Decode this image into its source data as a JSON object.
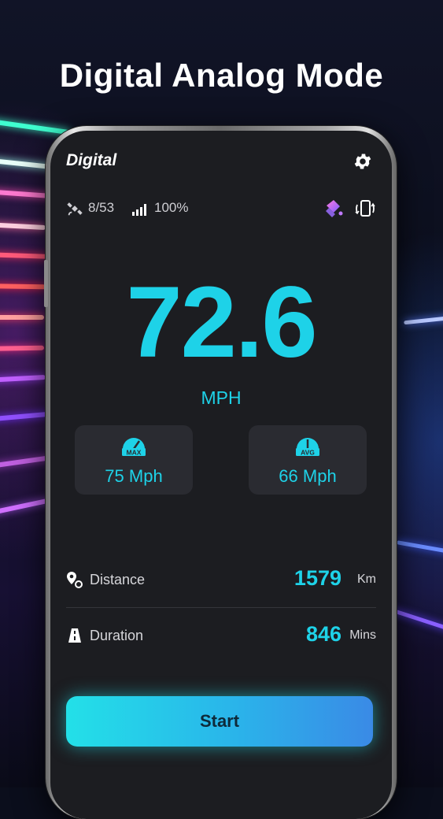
{
  "heading": "Digital Analog Mode",
  "app": {
    "title": "Digital",
    "settings_icon": "gear-icon",
    "status": {
      "satellites": "8/53",
      "signal": "100%",
      "satellite_icon": "satellite-icon",
      "signal_icon": "signal-bars-icon",
      "theme_icon": "paint-bucket-icon",
      "rotate_icon": "rotate-screen-icon"
    },
    "speed": {
      "value": "72.6",
      "unit": "MPH"
    },
    "stats": [
      {
        "badge": "MAX",
        "value": "75 Mph",
        "icon": "max-gauge-icon"
      },
      {
        "badge": "AVG",
        "value": "66 Mph",
        "icon": "avg-gauge-icon"
      }
    ],
    "metrics": [
      {
        "label": "Distance",
        "value": "1579",
        "unit": "Km",
        "icon": "location-pin-icon"
      },
      {
        "label": "Duration",
        "value": "846",
        "unit": "Mins",
        "icon": "road-icon"
      }
    ],
    "start_label": "Start"
  },
  "colors": {
    "accent": "#1ed2e8",
    "screen_bg": "#1c1d21",
    "card_bg": "#2a2b31",
    "button_gradient": [
      "#23e0e8",
      "#3a8ae6"
    ]
  }
}
